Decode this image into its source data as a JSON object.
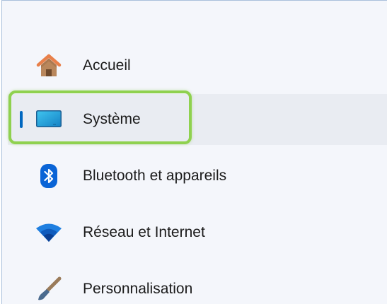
{
  "nav": {
    "items": [
      {
        "label": "Accueil",
        "icon": "home-icon",
        "selected": false
      },
      {
        "label": "Système",
        "icon": "monitor-icon",
        "selected": true
      },
      {
        "label": "Bluetooth et appareils",
        "icon": "bluetooth-icon",
        "selected": false
      },
      {
        "label": "Réseau et Internet",
        "icon": "wifi-icon",
        "selected": false
      },
      {
        "label": "Personnalisation",
        "icon": "brush-icon",
        "selected": false
      }
    ]
  },
  "colors": {
    "accent": "#0067c0",
    "highlight": "#8fd14f",
    "selected_background": "#e9ecf2"
  }
}
